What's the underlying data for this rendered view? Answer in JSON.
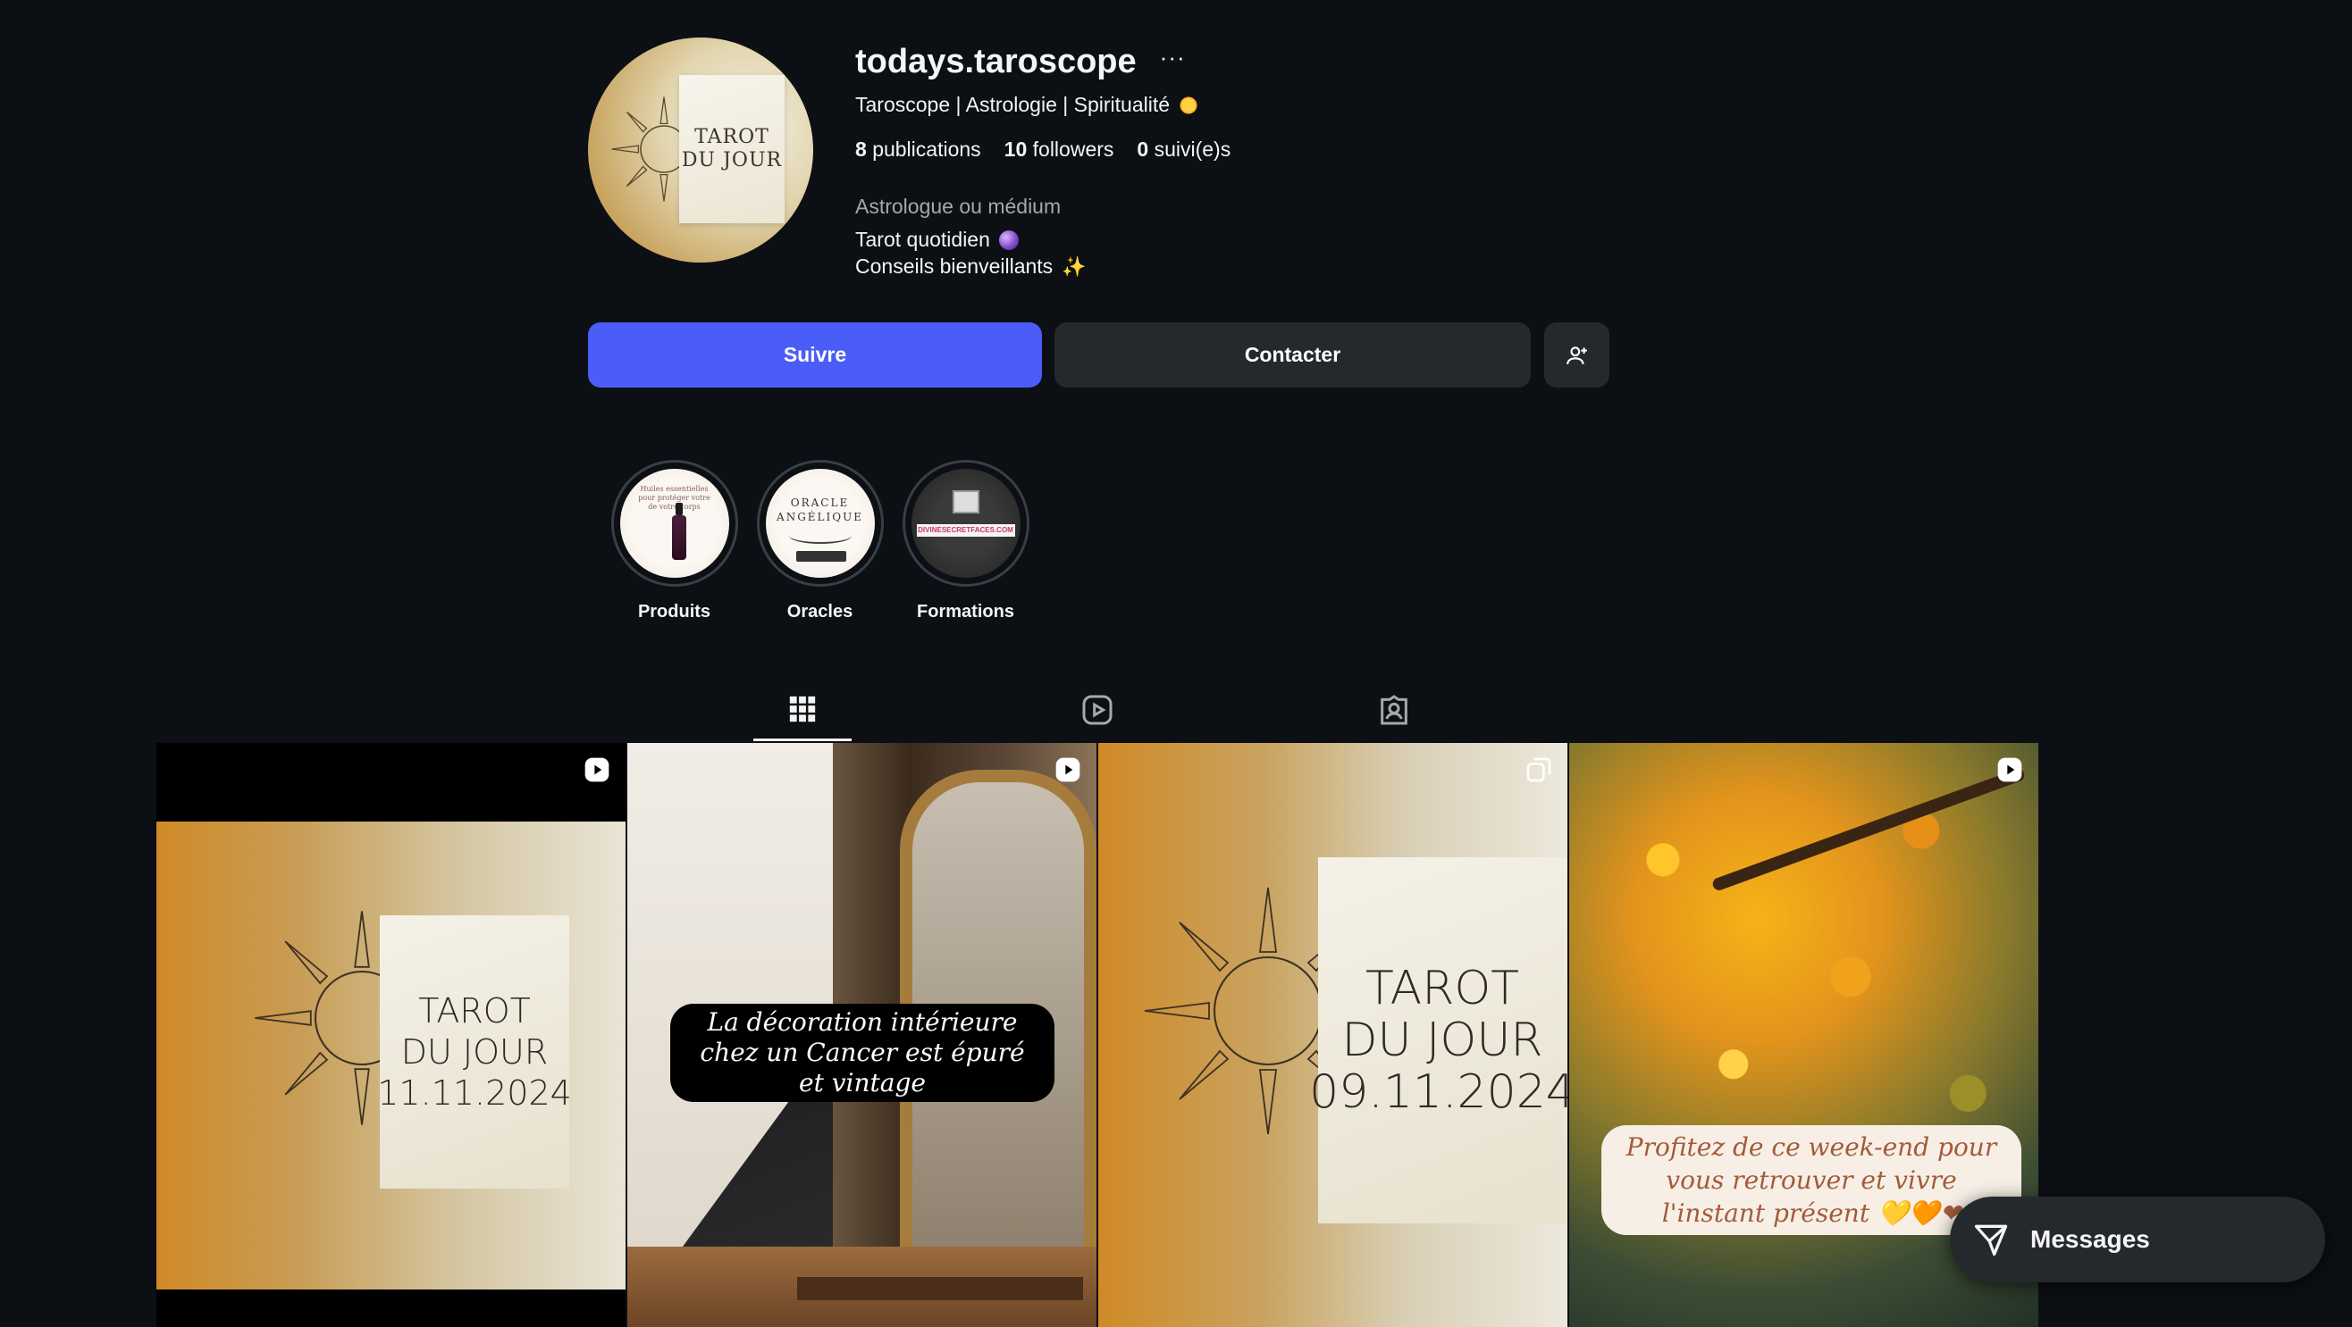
{
  "profile": {
    "username": "todays.taroscope",
    "more_glyph": "···",
    "tagline": "Taroscope | Astrologie | Spiritualité",
    "avatar_text": "TAROT\nDU JOUR",
    "stats": {
      "publications_count": "8",
      "publications_label": "publications",
      "followers_count": "10",
      "followers_label": "followers",
      "following_count": "0",
      "following_label": "suivi(e)s"
    },
    "category": "Astrologue ou médium",
    "bio": [
      "Tarot quotidien",
      "Conseils bienveillants"
    ]
  },
  "actions": {
    "follow": "Suivre",
    "contact": "Contacter",
    "add_user_icon": "person-add-icon"
  },
  "highlights": [
    {
      "label": "Produits",
      "art_text": "Huiles essentielles pour protéger votre de votre corps"
    },
    {
      "label": "Oracles",
      "art_text": "ORACLE\nANGÉLIQUE"
    },
    {
      "label": "Formations",
      "art_text": "DIVINESECRETFACES.COM"
    }
  ],
  "tabs": [
    {
      "name": "posts",
      "icon": "grid-icon",
      "active": true
    },
    {
      "name": "reels",
      "icon": "reels-icon",
      "active": false
    },
    {
      "name": "tagged",
      "icon": "tagged-icon",
      "active": false
    }
  ],
  "posts": [
    {
      "type": "reel",
      "card_text": "TAROT\nDU JOUR\n11.11.2024"
    },
    {
      "type": "reel",
      "caption": "La décoration intérieure chez un Cancer est épuré et vintage"
    },
    {
      "type": "carousel",
      "card_text": "TAROT\nDU JOUR\n09.11.2024"
    },
    {
      "type": "reel",
      "caption": "Profitez de ce week-end pour vous retrouver et vivre l'instant présent 💛🧡❤"
    }
  ],
  "messages": {
    "label": "Messages",
    "icon": "send-icon"
  },
  "colors": {
    "background": "#0c0f14",
    "follow_button": "#4a5df9",
    "secondary_button": "#25292e"
  }
}
